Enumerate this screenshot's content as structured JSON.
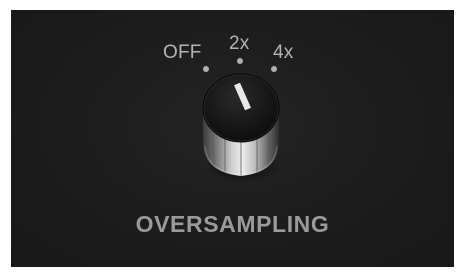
{
  "oversampling": {
    "title": "OVERSAMPLING",
    "positions": [
      "OFF",
      "2x",
      "4x"
    ],
    "selected": "OFF",
    "colors": {
      "panel": "#1c1c1c",
      "label": "#b4b4b4",
      "title": "#9a9a9a",
      "pointer": "#e8e8e8"
    }
  }
}
